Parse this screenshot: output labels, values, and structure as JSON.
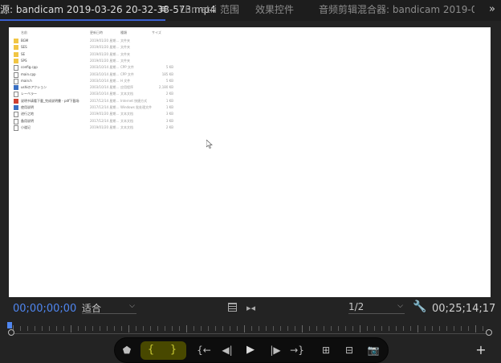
{
  "tabs": {
    "source": "源: bandicam 2019-03-26 20-32-38-573.mp4",
    "menu_icon": "≡",
    "lumetri": "Lumetri 范围",
    "effects": "效果控件",
    "mixer": "音频剪辑混合器: bandicam 2019-03-26 20-32",
    "more": "»"
  },
  "file_list": {
    "headers": [
      "名前",
      "更新日時",
      "種類",
      "サイズ"
    ],
    "rows": [
      {
        "name": "BGM",
        "date": "2019/01/20 星期...",
        "type": "文件夹",
        "size": "",
        "icon": "folder"
      },
      {
        "name": "SES",
        "date": "2019/01/20 星期...",
        "type": "文件夹",
        "size": "",
        "icon": "folder"
      },
      {
        "name": "SE",
        "date": "2019/01/20 星期...",
        "type": "文件夹",
        "size": "",
        "icon": "folder"
      },
      {
        "name": "SPS",
        "date": "2019/01/20 星期...",
        "type": "文件夹",
        "size": "",
        "icon": "folder"
      },
      {
        "name": "config.cpp",
        "date": "2003/10/14 星期...",
        "type": "CPP 文件",
        "size": "5 KB",
        "icon": "doc"
      },
      {
        "name": "main.cpp",
        "date": "2003/10/14 星期...",
        "type": "CPP 文件",
        "size": "185 KB",
        "icon": "doc"
      },
      {
        "name": "main.h",
        "date": "2003/10/14 星期...",
        "type": "H 文件",
        "size": "5 KB",
        "icon": "doc"
      },
      {
        "name": "ushiのアクション",
        "date": "2003/10/14 星期...",
        "type": "应用程序",
        "size": "2,180 KB",
        "icon": "blue"
      },
      {
        "name": "レーベラー",
        "date": "2003/10/14 星期...",
        "type": "文本文档",
        "size": "2 KB",
        "icon": "doc"
      },
      {
        "name": "说明书请看下載_完成说明書 - pdf下載场",
        "date": "2017/12/14 星期...",
        "type": "Internet 快捷方式",
        "size": "1 KB",
        "icon": "red"
      },
      {
        "name": "使用说明",
        "date": "2017/12/14 星期...",
        "type": "Windows 批处理文件",
        "size": "1 KB",
        "icon": "blue"
      },
      {
        "name": "进行之地",
        "date": "2019/01/20 星期...",
        "type": "文本文档",
        "size": "3 KB",
        "icon": "doc"
      },
      {
        "name": "备用说明",
        "date": "2017/12/14 星期...",
        "type": "文本文档",
        "size": "3 KB",
        "icon": "doc"
      },
      {
        "name": "小道记",
        "date": "2019/01/20 星期...",
        "type": "文本文档",
        "size": "2 KB",
        "icon": "doc"
      }
    ]
  },
  "controls": {
    "timecode_current": "00;00;00;00",
    "zoom": "适合",
    "resolution": "1/2",
    "timecode_duration": "00;25;14;17",
    "dropdown_arrow": "⌵",
    "settings_glyph": "🔧",
    "spread_glyph": "▸◂"
  },
  "transport": {
    "add_marker": "⬟",
    "mark_in": "{",
    "mark_out": "}",
    "go_to_in": "{←",
    "step_back": "◀|",
    "play": "▶",
    "step_forward": "|▶",
    "go_to_out": "→}",
    "insert": "⊞",
    "overwrite": "⊟",
    "camera": "📷",
    "add": "+"
  }
}
